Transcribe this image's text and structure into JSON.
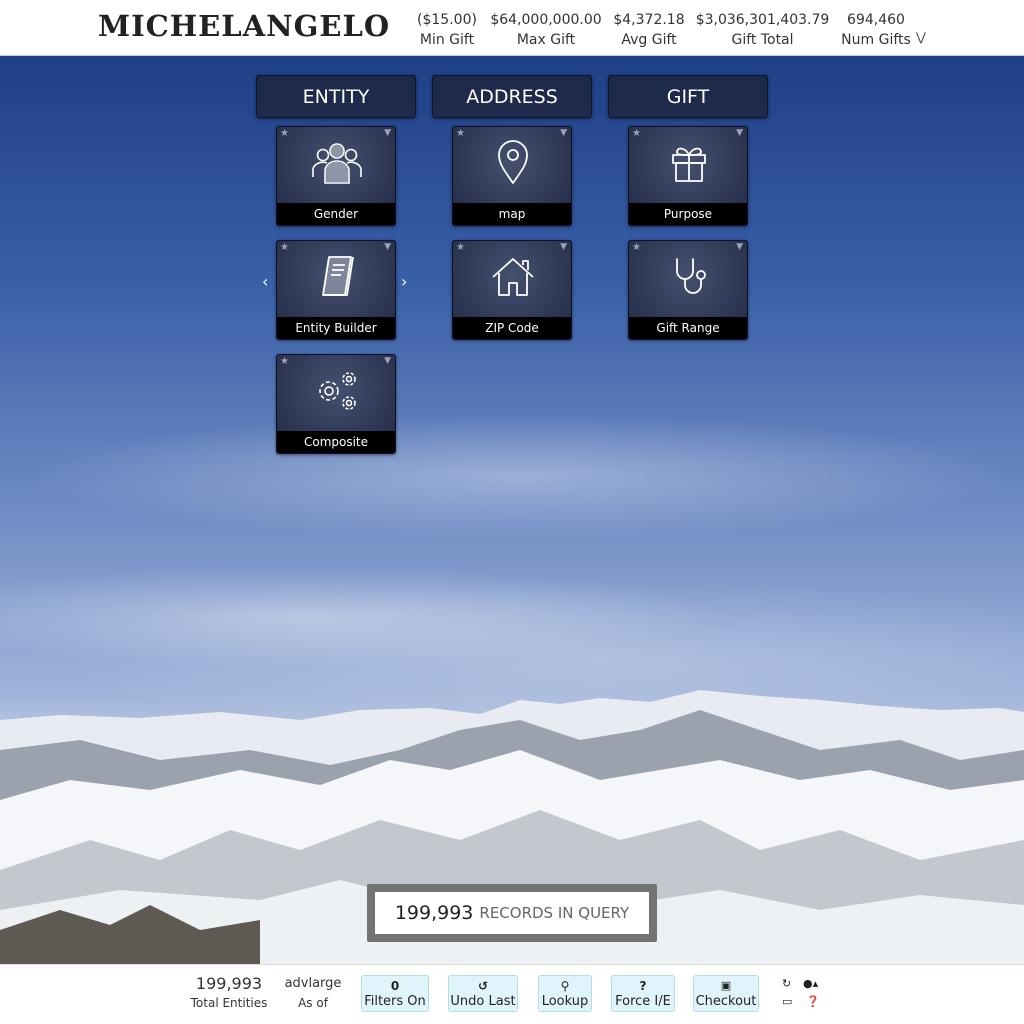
{
  "header": {
    "brand": "MICHELANGELO",
    "stats": [
      {
        "value": "($15.00)",
        "label": "Min Gift"
      },
      {
        "value": "$64,000,000.00",
        "label": "Max Gift"
      },
      {
        "value": "$4,372.18",
        "label": "Avg Gift"
      },
      {
        "value": "$3,036,301,403.79",
        "label": "Gift Total"
      },
      {
        "value": "694,460",
        "label": "Num Gifts"
      }
    ],
    "expand_icon": "double-chevron-down-icon"
  },
  "categories": [
    {
      "title": "ENTITY",
      "tiles": [
        {
          "label": "Gender",
          "icon": "users-icon"
        },
        {
          "label": "Entity Builder",
          "icon": "book-icon"
        },
        {
          "label": "Composite",
          "icon": "gears-icon"
        }
      ]
    },
    {
      "title": "ADDRESS",
      "tiles": [
        {
          "label": "map",
          "icon": "map-pin-icon"
        },
        {
          "label": "ZIP Code",
          "icon": "home-icon"
        }
      ]
    },
    {
      "title": "GIFT",
      "tiles": [
        {
          "label": "Purpose",
          "icon": "gift-icon"
        },
        {
          "label": "Gift Range",
          "icon": "stethoscope-icon"
        }
      ]
    }
  ],
  "records": {
    "count": "199,993",
    "label": "RECORDS IN QUERY"
  },
  "footer": {
    "total_entities": {
      "value": "199,993",
      "label": "Total Entities"
    },
    "as_of": {
      "value": "advlarge",
      "label": "As of"
    },
    "buttons": [
      {
        "icon_text": "0",
        "label": "Filters On",
        "icon": "count"
      },
      {
        "icon_text": "↺",
        "label": "Undo Last",
        "icon": "undo-icon"
      },
      {
        "icon_text": "⚲",
        "label": "Lookup",
        "icon": "search-icon"
      },
      {
        "icon_text": "?",
        "label": "Force I/E",
        "icon": "question-icon"
      },
      {
        "icon_text": "💾",
        "label": "Checkout",
        "icon": "save-icon"
      }
    ]
  },
  "colors": {
    "tile_bg": "#2b3552",
    "footer_button_bg": "#dff4fb",
    "sky": "#3a5fa8"
  }
}
